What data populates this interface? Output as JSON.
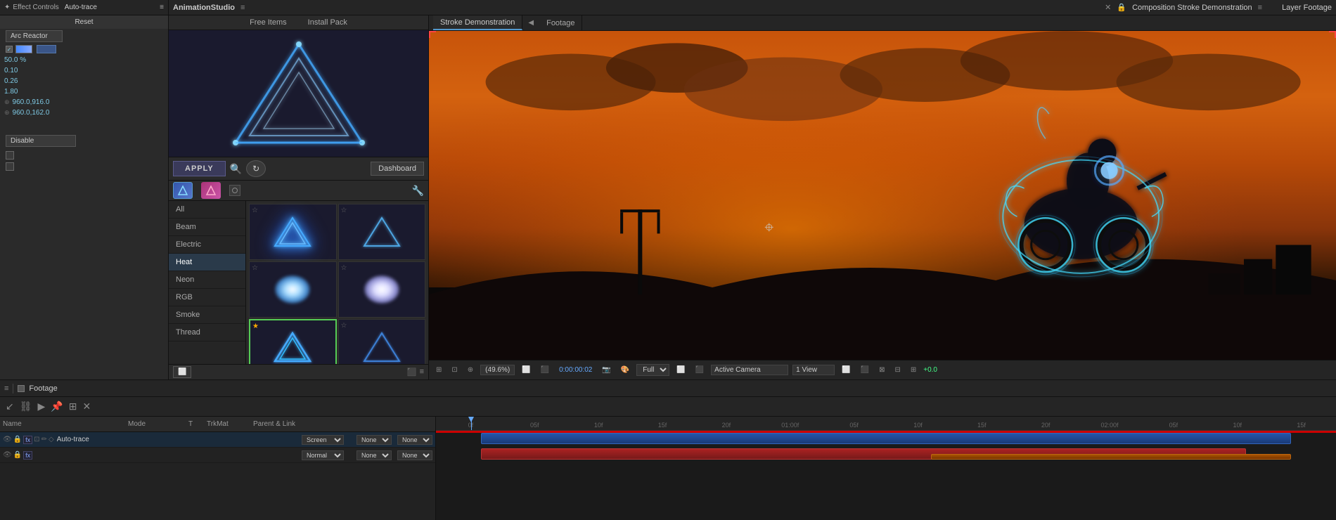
{
  "effectControls": {
    "panelTitle": "Effect Controls",
    "layerName": "Auto-trace",
    "resetLabel": "Reset",
    "presetLabel": "Arc Reactor",
    "checkboxChecked": true,
    "values": {
      "percent": "50.0 %",
      "v1": "0.10",
      "v2": "0.26",
      "v3": "1.80",
      "pos1": "960.0,916.0",
      "pos2": "960.0,162.0"
    },
    "disableLabel": "Disable"
  },
  "animationStudio": {
    "panelTitle": "AnimationStudio",
    "freeItemsLabel": "Free Items",
    "installPackLabel": "Install Pack",
    "applyLabel": "APPLY",
    "dashboardLabel": "Dashboard",
    "categories": [
      "All",
      "Beam",
      "Electric",
      "Heat",
      "Neon",
      "RGB",
      "Smoke",
      "Thread"
    ],
    "activeCategory": "Heat",
    "bottomIcons": [
      "⬜",
      "⬛",
      "≡"
    ]
  },
  "composition": {
    "panelTitle": "Composition Stroke Demonstration",
    "tabs": [
      "Stroke Demonstration",
      "Footage"
    ],
    "activeTab": "Stroke Demonstration",
    "layerFootageLabel": "Layer Footage",
    "bottomBar": {
      "zoomLevel": "(49.6%)",
      "timeCode": "0:00:00:02",
      "quality": "Full",
      "viewMode": "Active Camera",
      "viewCount": "1 View",
      "plusValue": "+0.0"
    }
  },
  "timeline": {
    "footageLabel": "Footage",
    "columns": {
      "name": "Name",
      "mode": "Mode",
      "t": "T",
      "trkmat": "TrkMat",
      "parentLink": "Parent & Link"
    },
    "layers": [
      {
        "name": "Auto-trace",
        "mode": "Screen",
        "modeNormal": "Normal",
        "t": "",
        "trkmat": "None",
        "parentLink": "None"
      }
    ],
    "rulerMarks": [
      "0f",
      "05f",
      "10f",
      "15f",
      "20f",
      "01:00f",
      "05f",
      "10f",
      "15f",
      "20f",
      "02:00f",
      "05f",
      "10f",
      "15f"
    ]
  },
  "icons": {
    "close": "✕",
    "menu": "≡",
    "star": "☆",
    "starFilled": "★",
    "wrench": "🔧",
    "search": "🔍",
    "lock": "🔒",
    "camera": "📷",
    "arrow": "▶",
    "chevronDown": "▼",
    "chevronRight": "▶",
    "play": "▶",
    "scissors": "✂",
    "link": "🔗",
    "box": "□",
    "diamond": "◇",
    "circle": "○"
  }
}
